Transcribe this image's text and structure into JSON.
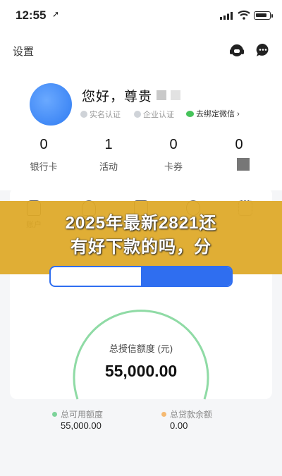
{
  "status_bar": {
    "time": "12:55",
    "location_arrow": "➚"
  },
  "header": {
    "settings_label": "设置",
    "support_icon": "headset-icon",
    "message_icon": "message-icon"
  },
  "profile": {
    "greeting": "您好，尊贵",
    "verify_real_name": "实名认证",
    "verify_company": "企业认证",
    "bind_wechat": "去绑定微信",
    "chevron": "›"
  },
  "stats": [
    {
      "value": "0",
      "label": "银行卡"
    },
    {
      "value": "1",
      "label": "活动"
    },
    {
      "value": "0",
      "label": "卡券"
    },
    {
      "value": "0",
      "label": ""
    }
  ],
  "services": [
    {
      "label": "账户",
      "icon": "bag-icon"
    },
    {
      "label": "",
      "icon": "person-icon"
    },
    {
      "label": "",
      "icon": "document-icon"
    },
    {
      "label": "",
      "icon": "gear-icon"
    },
    {
      "label": "",
      "icon": "grid-icon"
    }
  ],
  "banner": {
    "line1": "2025年最新2821还",
    "line2": "有好下款的吗，分"
  },
  "credit": {
    "total_label": "总授信额度 (元)",
    "total_value": "55,000.00",
    "available_label": "总可用额度",
    "available_value": "55,000.00",
    "loan_label": "总贷款余额",
    "loan_value": "0.00",
    "available_fraction": 1.0
  },
  "colors": {
    "accent": "#2f6ef0",
    "gauge_green": "#8fdba5",
    "available_dot": "#7dd39a",
    "loan_dot": "#f5b971",
    "banner": "#dea826"
  }
}
